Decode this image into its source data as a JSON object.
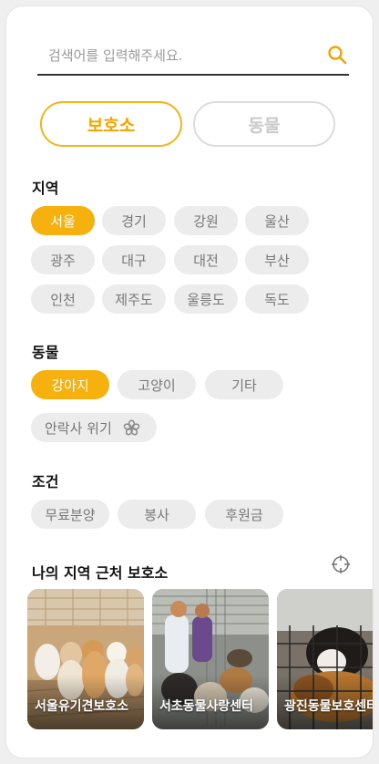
{
  "search": {
    "placeholder": "검색어를 입력해주세요."
  },
  "tabs": [
    {
      "label": "보호소",
      "active": true
    },
    {
      "label": "동물",
      "active": false
    }
  ],
  "region": {
    "title": "지역",
    "chips": [
      {
        "label": "서울",
        "selected": true
      },
      {
        "label": "경기",
        "selected": false
      },
      {
        "label": "강원",
        "selected": false
      },
      {
        "label": "울산",
        "selected": false
      },
      {
        "label": "광주",
        "selected": false
      },
      {
        "label": "대구",
        "selected": false
      },
      {
        "label": "대전",
        "selected": false
      },
      {
        "label": "부산",
        "selected": false
      },
      {
        "label": "인천",
        "selected": false
      },
      {
        "label": "제주도",
        "selected": false
      },
      {
        "label": "울릉도",
        "selected": false
      },
      {
        "label": "독도",
        "selected": false
      }
    ]
  },
  "animal": {
    "title": "동물",
    "chips": [
      {
        "label": "강아지",
        "selected": true
      },
      {
        "label": "고양이",
        "selected": false
      },
      {
        "label": "기타",
        "selected": false
      }
    ],
    "euthanasia_chip": {
      "label": "안락사 위기",
      "icon": "flower-icon"
    }
  },
  "condition": {
    "title": "조건",
    "chips": [
      {
        "label": "무료분양",
        "selected": false
      },
      {
        "label": "봉사",
        "selected": false
      },
      {
        "label": "후원금",
        "selected": false
      }
    ]
  },
  "nearby": {
    "title": "나의 지역 근처 보호소",
    "locate_icon": "crosshair-icon",
    "shelters": [
      {
        "name": "서울유기견보호소"
      },
      {
        "name": "서초동물사랑센터"
      },
      {
        "name": "광진동물보호센터"
      }
    ]
  },
  "colors": {
    "accent": "#f7b10e",
    "chip_bg": "#ececec",
    "chip_text": "#777777",
    "inactive_border": "#dcdcdc"
  }
}
